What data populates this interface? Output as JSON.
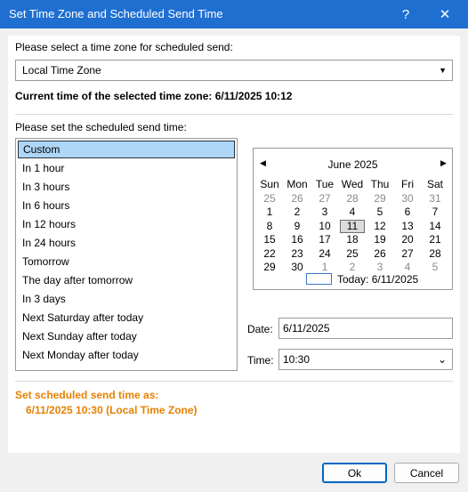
{
  "window": {
    "title": "Set Time Zone and Scheduled Send Time",
    "help_label": "?",
    "close_label": "✕"
  },
  "timezone": {
    "prompt": "Please select a time zone for scheduled send:",
    "selected": "Local Time Zone",
    "current_time": "Current time of the selected time zone: 6/11/2025 10:12"
  },
  "schedule": {
    "prompt": "Please set the scheduled send time:",
    "options": [
      "Custom",
      "In 1 hour",
      "In 3 hours",
      "In 6 hours",
      "In 12 hours",
      "In 24 hours",
      "Tomorrow",
      "The day after tomorrow",
      "In 3 days",
      "Next Saturday after today",
      "Next Sunday after today",
      "Next Monday after today"
    ],
    "selected_index": 0
  },
  "calendar": {
    "month_label": "June 2025",
    "prev_label": "◀",
    "next_label": "▶",
    "weekdays": [
      "Sun",
      "Mon",
      "Tue",
      "Wed",
      "Thu",
      "Fri",
      "Sat"
    ],
    "weeks": [
      [
        "25",
        "26",
        "27",
        "28",
        "29",
        "30",
        "31"
      ],
      [
        "1",
        "2",
        "3",
        "4",
        "5",
        "6",
        "7"
      ],
      [
        "8",
        "9",
        "10",
        "11",
        "12",
        "13",
        "14"
      ],
      [
        "15",
        "16",
        "17",
        "18",
        "19",
        "20",
        "21"
      ],
      [
        "22",
        "23",
        "24",
        "25",
        "26",
        "27",
        "28"
      ],
      [
        "29",
        "30",
        "1",
        "2",
        "3",
        "4",
        "5"
      ]
    ],
    "gray_cells": [
      [
        0,
        0
      ],
      [
        0,
        1
      ],
      [
        0,
        2
      ],
      [
        0,
        3
      ],
      [
        0,
        4
      ],
      [
        0,
        5
      ],
      [
        0,
        6
      ],
      [
        5,
        2
      ],
      [
        5,
        3
      ],
      [
        5,
        4
      ],
      [
        5,
        5
      ],
      [
        5,
        6
      ]
    ],
    "today_cell": [
      2,
      3
    ],
    "today_label": "Today: 6/11/2025"
  },
  "date_field": {
    "label": "Date:",
    "value": "6/11/2025"
  },
  "time_field": {
    "label": "Time:",
    "value": "10:30"
  },
  "summary": {
    "heading": "Set scheduled send time as:",
    "value": "6/11/2025 10:30 (Local Time Zone)"
  },
  "buttons": {
    "ok": "Ok",
    "cancel": "Cancel"
  },
  "colors": {
    "titlebar": "#1f6fd1",
    "accent_orange": "#e68100",
    "selection": "#aed6f7"
  }
}
